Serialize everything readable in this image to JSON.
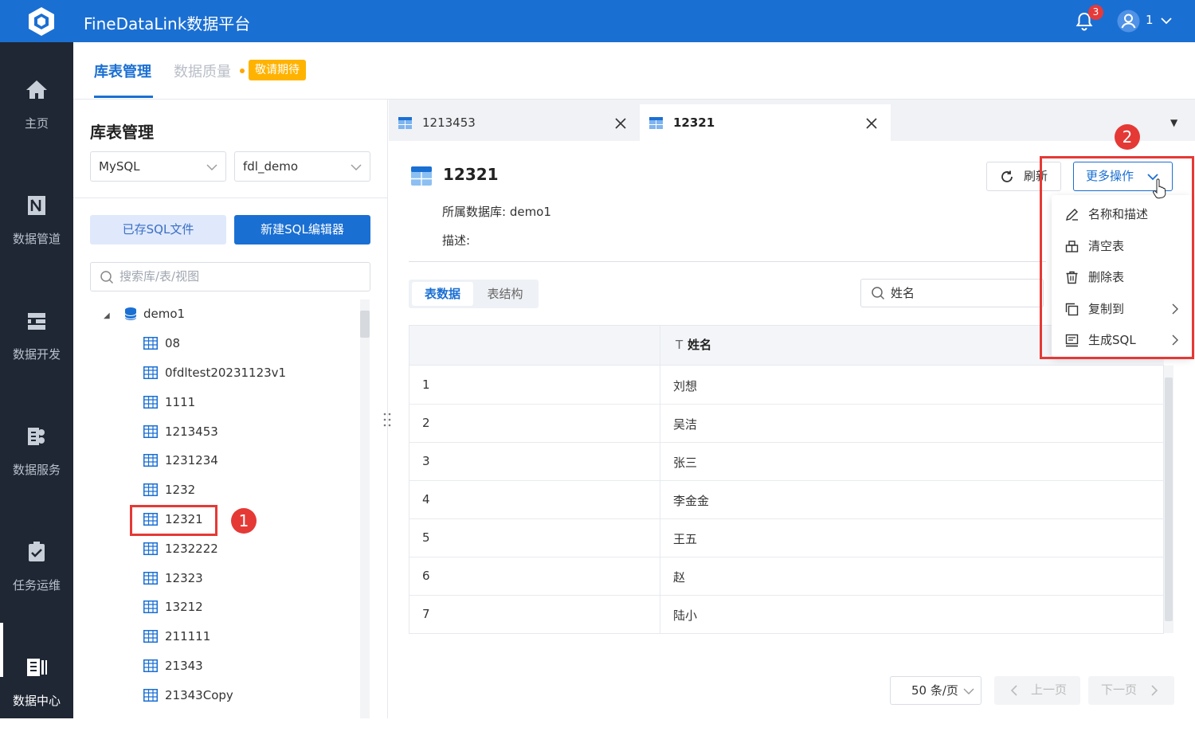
{
  "header": {
    "app_title": "FineDataLink数据平台",
    "notification_count": "3",
    "username": "1"
  },
  "sidebar": {
    "items": [
      {
        "label": "主页",
        "icon": "home-icon"
      },
      {
        "label": "数据管道",
        "icon": "pipeline-icon"
      },
      {
        "label": "数据开发",
        "icon": "dev-icon"
      },
      {
        "label": "数据服务",
        "icon": "service-icon"
      },
      {
        "label": "任务运维",
        "icon": "ops-icon"
      },
      {
        "label": "数据中心",
        "icon": "datacenter-icon",
        "active": true
      }
    ]
  },
  "subtabs": {
    "tab1": "库表管理",
    "tab2": "数据质量",
    "coming_soon": "敬请期待"
  },
  "left_panel": {
    "title": "库表管理",
    "db_type": "MySQL",
    "db_name": "fdl_demo",
    "saved_sql": "已存SQL文件",
    "new_sql": "新建SQL编辑器",
    "search_placeholder": "搜索库/表/视图",
    "root": "demo1",
    "tables": [
      "08",
      "0fdltest20231123v1",
      "1111",
      "1213453",
      "1231234",
      "1232",
      "12321",
      "1232222",
      "12323",
      "13212",
      "211111",
      "21343",
      "21343Copy"
    ]
  },
  "annotations": {
    "step1": "1",
    "step2": "2"
  },
  "doc_tabs": [
    {
      "label": "1213453"
    },
    {
      "label": "12321"
    }
  ],
  "detail": {
    "table_name": "12321",
    "database_label": "所属数据库: demo1",
    "desc_label": "描述:",
    "refresh": "刷新",
    "more_ops": "更多操作",
    "seg_data": "表数据",
    "seg_struct": "表结构",
    "filter_value": "姓名"
  },
  "menu": {
    "items": [
      {
        "label": "名称和描述",
        "icon": "edit-icon"
      },
      {
        "label": "清空表",
        "icon": "eraser-icon"
      },
      {
        "label": "删除表",
        "icon": "trash-icon"
      },
      {
        "label": "复制到",
        "icon": "copy-icon",
        "submenu": true
      },
      {
        "label": "生成SQL",
        "icon": "sql-icon",
        "submenu": true
      }
    ]
  },
  "grid": {
    "column": "姓名",
    "rows": [
      {
        "n": "1",
        "name": "刘想"
      },
      {
        "n": "2",
        "name": "吴洁"
      },
      {
        "n": "3",
        "name": "张三"
      },
      {
        "n": "4",
        "name": "李金金"
      },
      {
        "n": "5",
        "name": "王五"
      },
      {
        "n": "6",
        "name": "赵"
      },
      {
        "n": "7",
        "name": "陆小"
      }
    ]
  },
  "pager": {
    "page_size": "50 条/页",
    "prev": "上一页",
    "next": "下一页"
  },
  "colors": {
    "brand": "#1a6fd3",
    "nav_bg": "#1f2734",
    "highlight": "#e53935"
  }
}
